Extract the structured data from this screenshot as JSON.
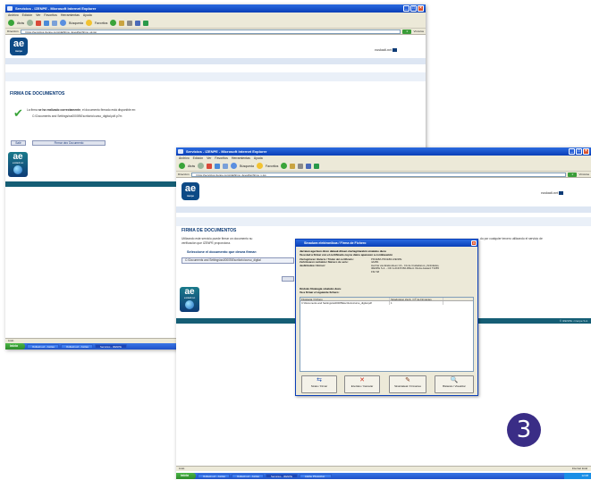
{
  "back_window": {
    "title": "Servicios - IZENPE - Microsoft Internet Explorer",
    "menu": [
      "Archivo",
      "Edición",
      "Ver",
      "Favoritos",
      "Herramientas",
      "Ayuda"
    ],
    "toolbar": {
      "back": "Atrás",
      "search": "Búsqueda",
      "favorites": "Favoritos"
    },
    "address_label": "Dirección",
    "address": "https://servicios.izenpe.com/platfirma_devel/jsp/firma_ok.jsp",
    "go": "Ir",
    "links": "Vínculos",
    "logo": "ae",
    "logo_sub": "izenpe",
    "brand": "euskadi.net",
    "heading": "FIRMA DE DOCUMENTOS",
    "msg_prefix": "La firma ",
    "msg_bold": "se ha realizado correctamente",
    "msg_suffix": ", el documento firmado está disponible en:",
    "msg_path": "C:\\Documents and Settings\\ss00005\\Escritorio\\curso_digital.pdf.p7m",
    "btn_exit": "Salir",
    "btn_sign_other": "Firmar otro Documento",
    "badge": "ae",
    "badge_sub": "euskadi.net",
    "status": "Listo",
    "taskbar": {
      "start": "inicio",
      "tasks": [
        "Outlook ext - Juntas",
        "Outlook ext - Juntas",
        "Servicios - IZENPE"
      ]
    }
  },
  "front_window": {
    "title": "Servicios - IZENPE - Microsoft Internet Explorer",
    "menu": [
      "Archivo",
      "Edición",
      "Ver",
      "Favoritos",
      "Herramientas",
      "Ayuda"
    ],
    "toolbar": {
      "back": "Atrás",
      "search": "Búsqueda",
      "favorites": "Favoritos"
    },
    "address_label": "Dirección",
    "address": "https://servicios.izenpe.com/platfirma_devel/jsp/firma_x.jsp",
    "go": "Ir",
    "links": "Vínculos",
    "logo": "ae",
    "logo_sub": "izenpe",
    "brand": "euskadi.net",
    "heading": "FIRMA DE DOCUMENTOS",
    "intro_1": "Utilizando este servicio puede firmar un documento su",
    "intro_2": "verificación que IZENPE proporciona.",
    "intro_right": "do por cualquier tercero utilizando el servicio de",
    "select_label": "Seleccione el documento que desea firmar:",
    "select_path": "C:\\Documents and Settings\\ss00005\\Escritorio\\curso_digital",
    "badge": "ae",
    "badge_sub": "euskadi.net",
    "footer_right": "© IZENPE • Izenpe S.A.",
    "status": "Listo",
    "status_right": "Internet local",
    "taskbar": {
      "start": "inicio",
      "tasks": [
        "Outlook ext - Juntas",
        "Outlook ext - Juntas",
        "Servicios - IZENPE",
        "Adobe Photoshop"
      ],
      "tray": "12:08"
    }
  },
  "dialog": {
    "title": "Sinadura elektronikoa / Firma de Fichero",
    "intro_lines": [
      "Jarraian agertzen diren datuak dituen ziurtagiriarekin sinatuko duzu",
      "Va usted a firmar con el certificado cuyos datos aparecen a continuación"
    ],
    "fields": [
      {
        "label": "Ziurtagiriaren titularra / Titular del certificado:",
        "value": "PRUEBA PRUEBA IZENPE"
      },
      {
        "label": "Zerbitzuaren zenbakia / Número de serie:",
        "value": "4A2B1"
      },
      {
        "label": "Jaulkitzailea / Emisor:",
        "value": "Herritar eta Erakundeen CA - CA de Ciudadanos y Entidades, IZENPE S.A. - CIF A-01337260-RMerc.Vitoria-Gasteiz T1055 F62 S8"
      }
    ],
    "files_intro": [
      "Ondoko fitxategia sinatuko duzu",
      "Va a firmar el siguiente fichero:"
    ],
    "list_columns": [
      "Fitxategia / Fichero",
      "Sinaduraren Zenb. / Nº de Firmantes"
    ],
    "list_rows": [
      [
        "C:\\Documents and Settings\\ss00005\\Escritorio\\curso_digital.pdf",
        "1"
      ]
    ],
    "actions": [
      {
        "icon": "⇆",
        "label": "Sinatu / Firmar"
      },
      {
        "icon": "✕",
        "label": "Ezeztatu / Cancelar"
      },
      {
        "icon": "✎",
        "label": "Sinatzaileak / Firmantes"
      },
      {
        "icon": "🔍",
        "label": "Bistaratu / Visualizar"
      }
    ]
  },
  "step_number": "3",
  "colors": {
    "ie_titlebar": "#0a3fb8",
    "heading": "#0d3b76",
    "teal_footer": "#155e75",
    "step_badge": "#3a2d86"
  }
}
